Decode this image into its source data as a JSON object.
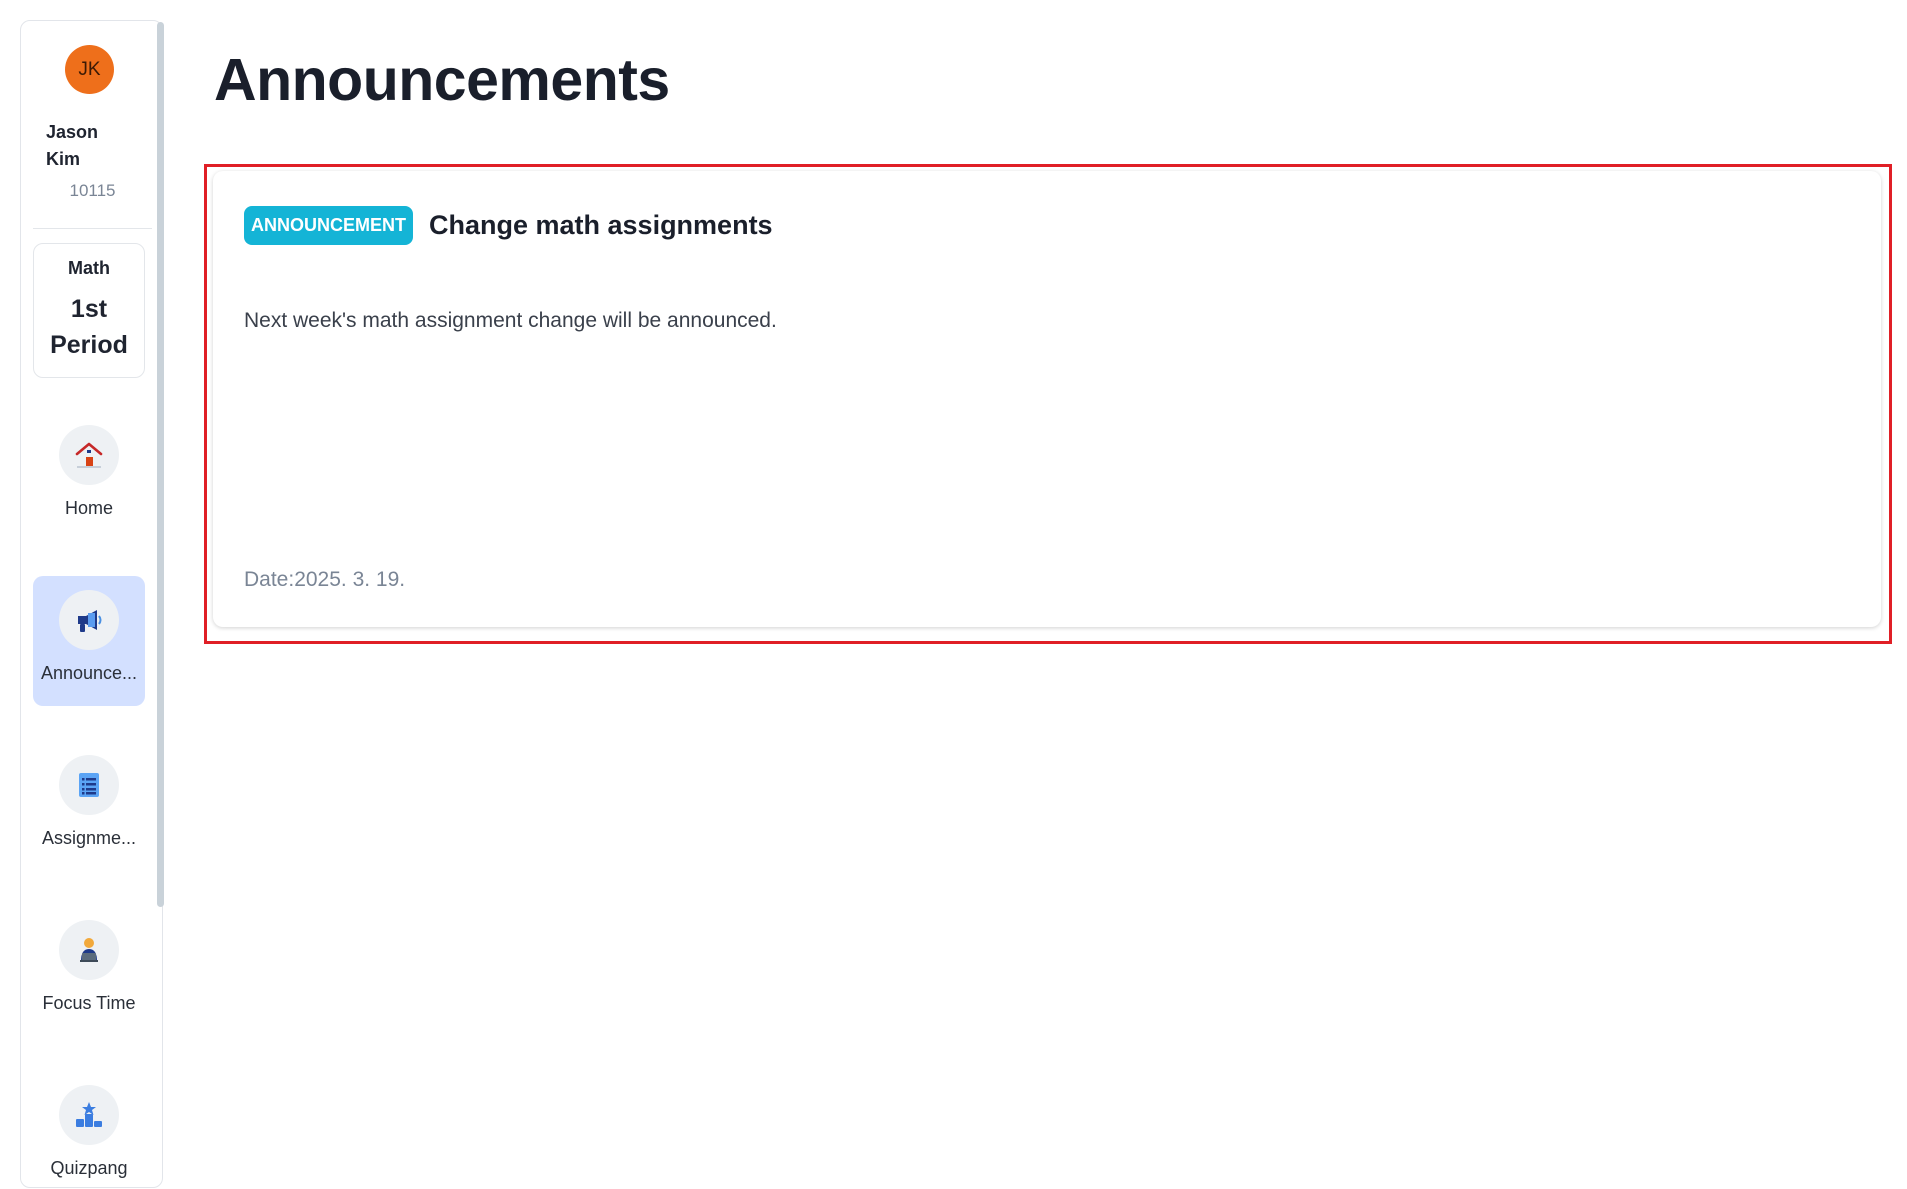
{
  "user": {
    "initials": "JK",
    "first_name": "Jason",
    "last_name": "Kim",
    "id": "10115"
  },
  "class_info": {
    "subject": "Math",
    "period_line1": "1st",
    "period_line2": "Period"
  },
  "nav": {
    "items": [
      {
        "label": "Home",
        "icon": "house-icon",
        "active": false
      },
      {
        "label": "Announce...",
        "icon": "megaphone-icon",
        "active": true
      },
      {
        "label": "Assignme...",
        "icon": "list-icon",
        "active": false
      },
      {
        "label": "Focus Time",
        "icon": "person-laptop-icon",
        "active": false
      },
      {
        "label": "Quizpang",
        "icon": "podium-icon",
        "active": false
      }
    ]
  },
  "page": {
    "title": "Announcements"
  },
  "announcement": {
    "badge": "ANNOUNCEMENT",
    "title": "Change math assignments",
    "body": "Next week's math assignment change will be announced.",
    "date": "Date:2025. 3. 19."
  },
  "colors": {
    "avatar": "#ee6f1b",
    "badge": "#14b4d6",
    "active_nav": "#d3e0ff",
    "highlight_border": "#e01f26"
  }
}
